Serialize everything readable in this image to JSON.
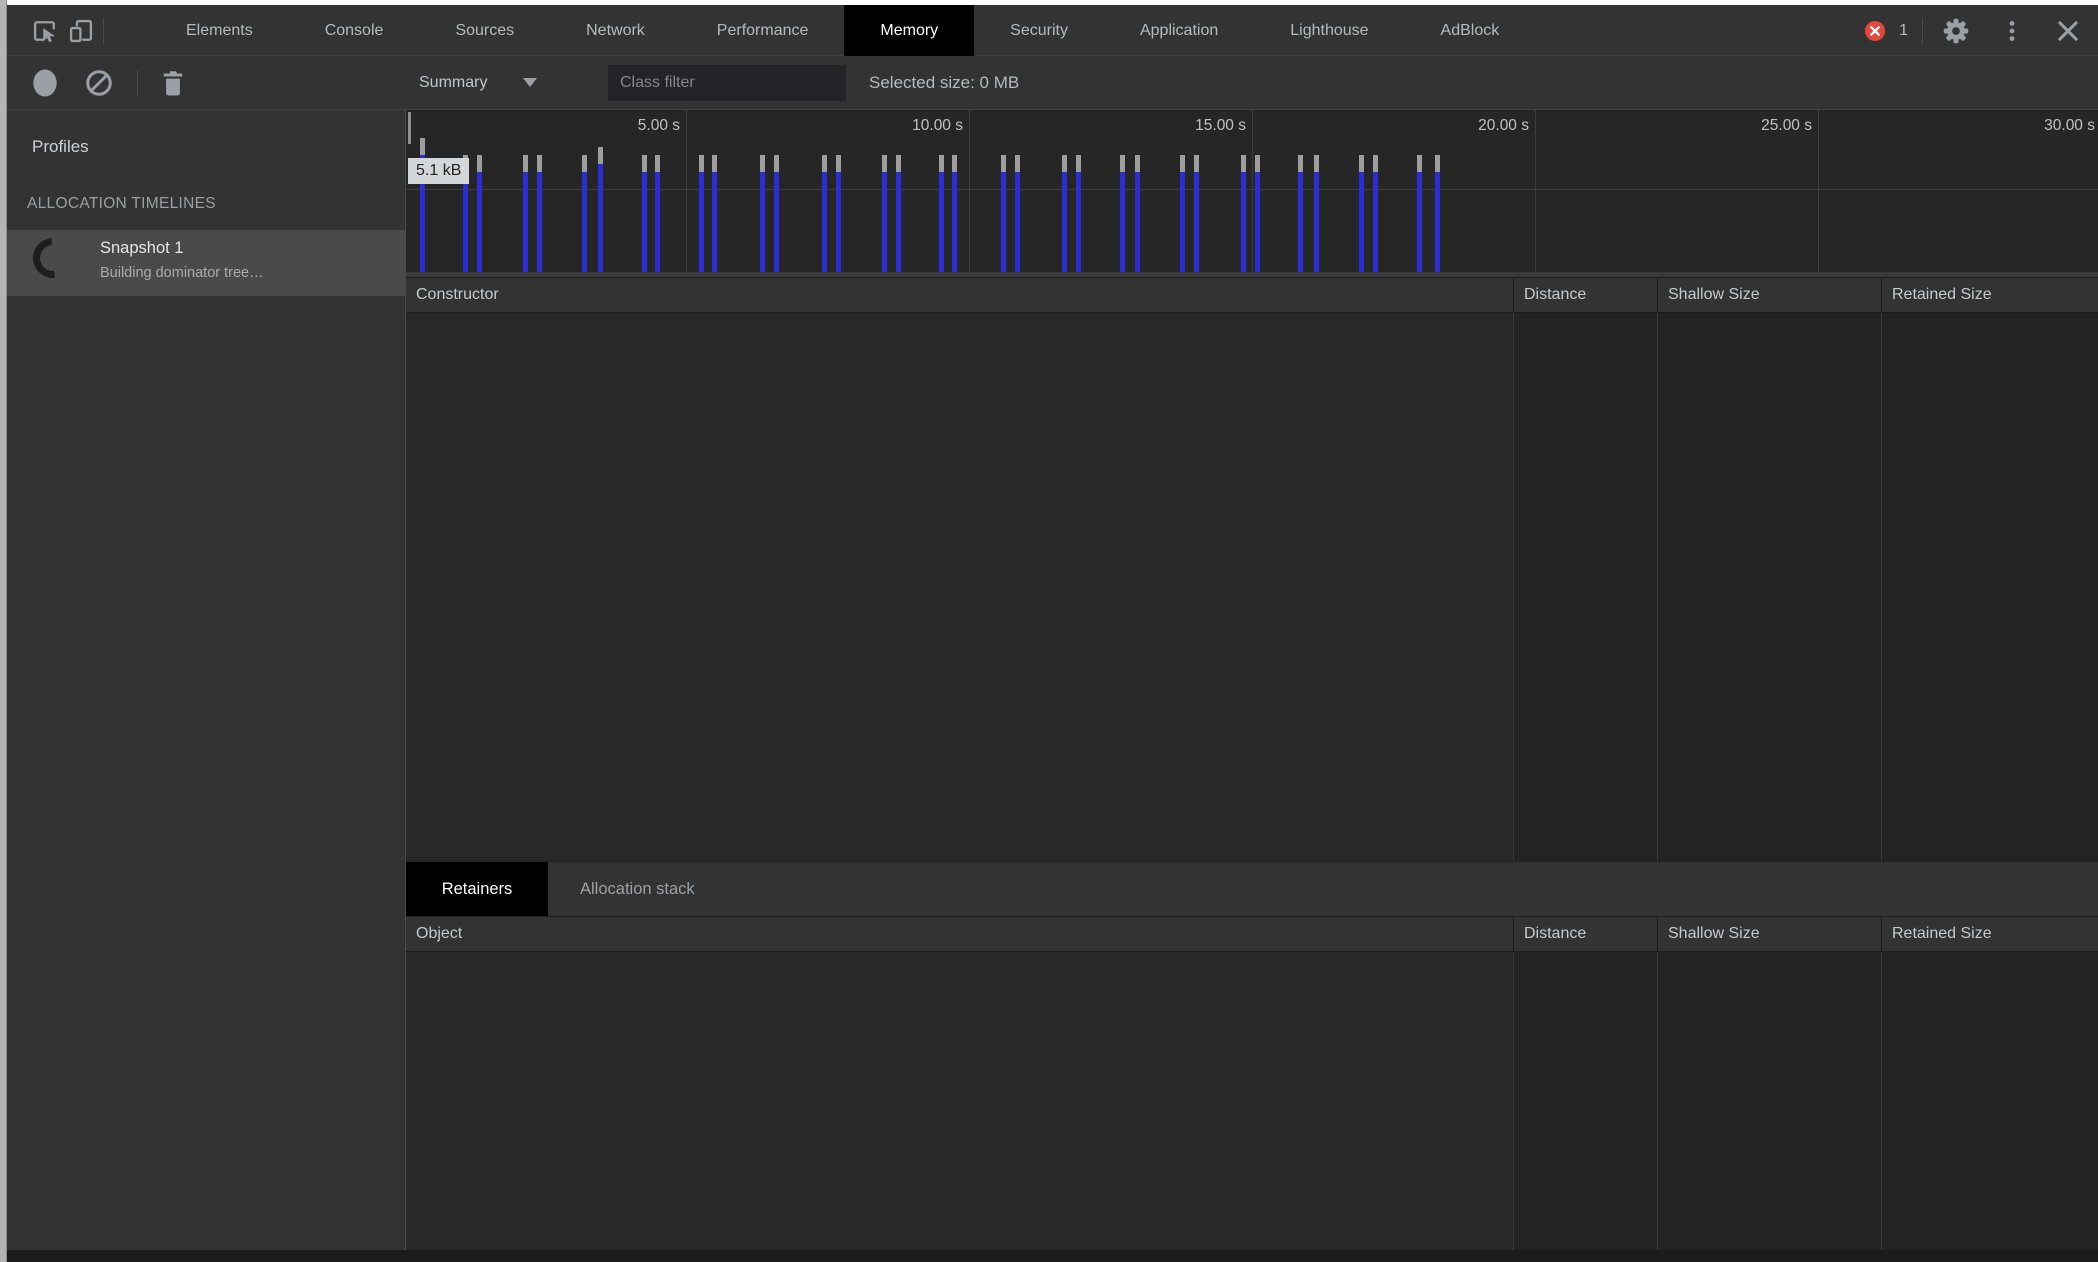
{
  "window": {
    "tabs": [
      {
        "label": "Elements",
        "selected": false
      },
      {
        "label": "Console",
        "selected": false
      },
      {
        "label": "Sources",
        "selected": false
      },
      {
        "label": "Network",
        "selected": false
      },
      {
        "label": "Performance",
        "selected": false
      },
      {
        "label": "Memory",
        "selected": true
      },
      {
        "label": "Security",
        "selected": false
      },
      {
        "label": "Application",
        "selected": false
      },
      {
        "label": "Lighthouse",
        "selected": false
      },
      {
        "label": "AdBlock",
        "selected": false
      }
    ],
    "error_count": "1"
  },
  "toolbar": {
    "summary_label": "Summary",
    "class_filter_placeholder": "Class filter",
    "selected_size": "Selected size: 0 MB"
  },
  "sidebar": {
    "profiles_label": "Profiles",
    "section_header": "ALLOCATION TIMELINES",
    "snapshot": {
      "title": "Snapshot 1",
      "status": "Building dominator tree…"
    }
  },
  "chart_data": {
    "type": "bar",
    "description": "Memory allocation timeline: vertical bars mark allocation events over time; bar height is allocation size relative to the 5.1 kB maximum; gray caps mark still-live portions",
    "x_range_seconds": [
      0,
      30
    ],
    "x_ticks": [
      {
        "s": 5,
        "label": "5.00 s"
      },
      {
        "s": 10,
        "label": "10.00 s"
      },
      {
        "s": 15,
        "label": "15.00 s"
      },
      {
        "s": 20,
        "label": "20.00 s"
      },
      {
        "s": 25,
        "label": "25.00 s"
      },
      {
        "s": 30,
        "label": "30.00 s"
      }
    ],
    "y_max_label": "5.1 kB",
    "h_unit": "fraction of 5.1 kB max",
    "bars": [
      {
        "t": 0.3,
        "h": 1.0
      },
      {
        "t": 1.06,
        "h": 0.87
      },
      {
        "t": 1.31,
        "h": 0.87
      },
      {
        "t": 2.12,
        "h": 0.87
      },
      {
        "t": 2.37,
        "h": 0.87
      },
      {
        "t": 3.16,
        "h": 0.87
      },
      {
        "t": 3.45,
        "h": 0.93
      },
      {
        "t": 4.22,
        "h": 0.87
      },
      {
        "t": 4.45,
        "h": 0.87
      },
      {
        "t": 5.23,
        "h": 0.87
      },
      {
        "t": 5.46,
        "h": 0.87
      },
      {
        "t": 6.31,
        "h": 0.87
      },
      {
        "t": 6.55,
        "h": 0.87
      },
      {
        "t": 7.4,
        "h": 0.87
      },
      {
        "t": 7.65,
        "h": 0.87
      },
      {
        "t": 8.46,
        "h": 0.87
      },
      {
        "t": 8.71,
        "h": 0.87
      },
      {
        "t": 9.47,
        "h": 0.87
      },
      {
        "t": 9.7,
        "h": 0.87
      },
      {
        "t": 10.57,
        "h": 0.87
      },
      {
        "t": 10.81,
        "h": 0.87
      },
      {
        "t": 11.64,
        "h": 0.87
      },
      {
        "t": 11.89,
        "h": 0.87
      },
      {
        "t": 12.67,
        "h": 0.87
      },
      {
        "t": 12.93,
        "h": 0.87
      },
      {
        "t": 13.73,
        "h": 0.87
      },
      {
        "t": 13.98,
        "h": 0.87
      },
      {
        "t": 14.81,
        "h": 0.87
      },
      {
        "t": 15.05,
        "h": 0.87
      },
      {
        "t": 15.81,
        "h": 0.87
      },
      {
        "t": 16.1,
        "h": 0.87
      },
      {
        "t": 16.89,
        "h": 0.87
      },
      {
        "t": 17.14,
        "h": 0.87
      },
      {
        "t": 17.92,
        "h": 0.87
      },
      {
        "t": 18.23,
        "h": 0.87
      }
    ]
  },
  "constructor_table": {
    "columns": [
      "Constructor",
      "Distance",
      "Shallow Size",
      "Retained Size"
    ]
  },
  "retainers_tabs": {
    "items": [
      "Retainers",
      "Allocation stack"
    ],
    "selected_index": 0
  },
  "object_table": {
    "columns": [
      "Object",
      "Distance",
      "Shallow Size",
      "Retained Size"
    ]
  },
  "icons": {
    "left_of_tabs": [
      "inspect-icon",
      "device-toolbar-icon"
    ],
    "toolbar": [
      "record-icon",
      "block-icon",
      "trash-icon"
    ],
    "right_of_tabs": [
      "error-badge-icon",
      "gear-icon",
      "kebab-icon",
      "close-icon"
    ]
  },
  "colors": {
    "chrome_bg": "#333333",
    "panel_bg": "#262626",
    "selected_tab_bg": "#000000",
    "selected_item_bg": "#4a4a4a",
    "bar_blue": "#2d2dd6",
    "bar_cap_gray": "#9e9e9e",
    "tooltip_bg": "#d4d7da",
    "error_red": "#e8453c",
    "icon_gray": "#9aa0a6"
  }
}
